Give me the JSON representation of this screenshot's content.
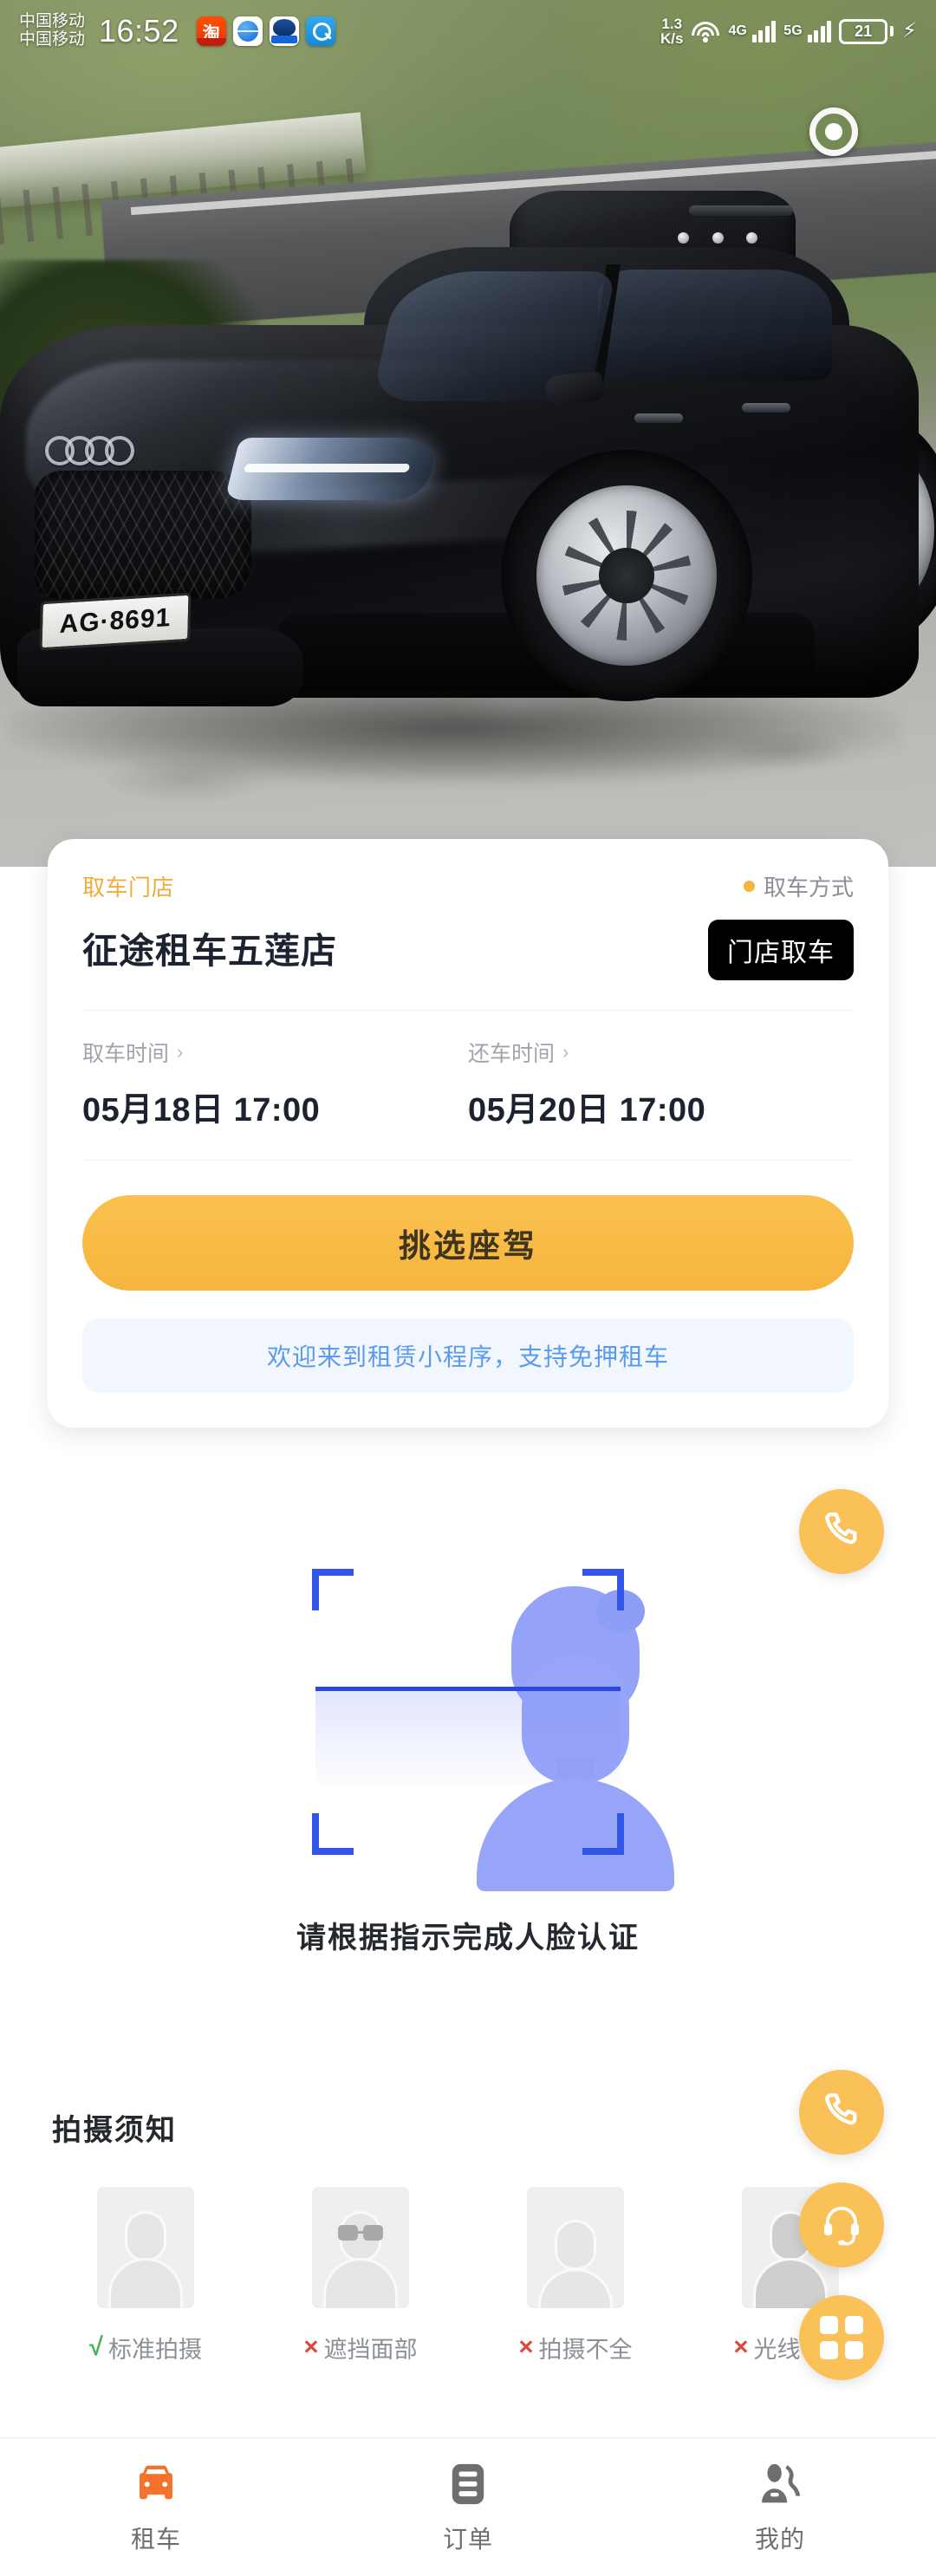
{
  "status_bar": {
    "carrier_line1": "中国移动",
    "carrier_line2": "中国移动",
    "time": "16:52",
    "net_speed_value": "1.3",
    "net_speed_unit": "K/s",
    "signal_label_1": "4G",
    "signal_label_2": "5G",
    "battery_level": "21",
    "app_icons": [
      "taobao-icon",
      "globe-icon",
      "blue-app-icon",
      "search-app-icon"
    ]
  },
  "hero": {
    "target_button": "target-icon",
    "license_plate": "AG·8691"
  },
  "card": {
    "store_label": "取车门店",
    "store_name": "征途租车五莲店",
    "pickup_method_label": "取车方式",
    "pickup_method_value": "门店取车",
    "pickup_time_label": "取车时间",
    "pickup_time_value": "05月18日 17:00",
    "return_time_label": "还车时间",
    "return_time_value": "05月20日 17:00",
    "chevron": "›",
    "select_car_button": "挑选座驾",
    "notice": "欢迎来到租赁小程序，支持免押租车"
  },
  "face_auth": {
    "caption": "请根据指示完成人脸认证"
  },
  "guidelines": {
    "title": "拍摄须知",
    "items": [
      {
        "mark": "√",
        "ok": true,
        "label": "标准拍摄"
      },
      {
        "mark": "×",
        "ok": false,
        "label": "遮挡面部"
      },
      {
        "mark": "×",
        "ok": false,
        "label": "拍摄不全"
      },
      {
        "mark": "×",
        "ok": false,
        "label": "光线不全"
      }
    ]
  },
  "fabs": [
    {
      "name": "phone-icon",
      "label": "电话"
    },
    {
      "name": "phone-icon",
      "label": "电话"
    },
    {
      "name": "headset-icon",
      "label": "客服"
    },
    {
      "name": "grid-icon",
      "label": "菜单"
    }
  ],
  "tabbar": {
    "items": [
      {
        "label": "租车",
        "icon": "car-icon",
        "active": true
      },
      {
        "label": "订单",
        "icon": "order-icon",
        "active": false
      },
      {
        "label": "我的",
        "icon": "user-icon",
        "active": false
      }
    ]
  },
  "colors": {
    "accent": "#fac158",
    "button": "#f6b53d",
    "store_label": "#f0ad3e",
    "notice_text": "#5b9bef",
    "notice_bg": "#f2f6fd",
    "scan_blue": "#3355e8",
    "avatar_blue": "#97a5f8",
    "ok_green": "#44b552",
    "error_red": "#e0453c",
    "tab_active": "#f4722b"
  }
}
